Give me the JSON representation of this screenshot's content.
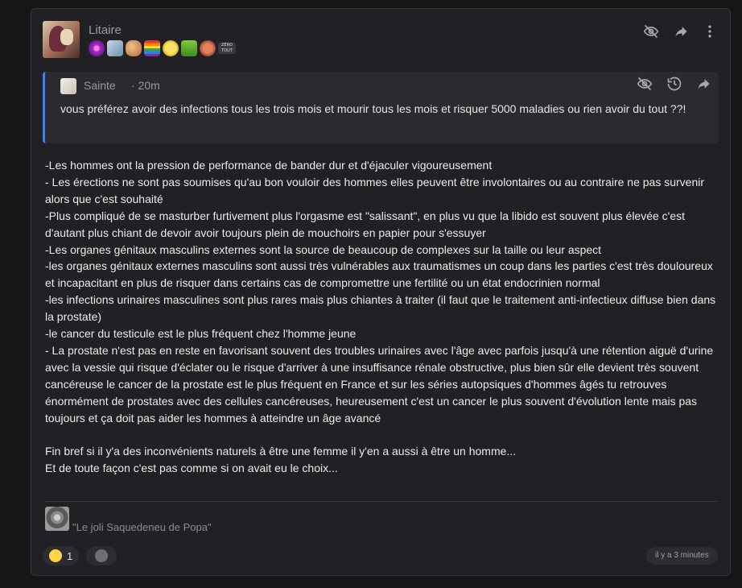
{
  "post": {
    "author": "Litaire",
    "badges": [
      "spiral-badge",
      "character-badge",
      "figure-badge",
      "rainbow-flag-badge",
      "smiley-badge",
      "green-badge",
      "face-badge",
      "text-badge"
    ],
    "badge_text": "ZÉRO TOUT",
    "actions": [
      "hide-icon",
      "share-icon",
      "more-icon"
    ]
  },
  "quote": {
    "author": "Sainte",
    "time": "· 20m",
    "text": "vous préférez avoir des infections tous les trois mois et mourir tous les mois et risquer 5000 maladies ou rien avoir du tout ??!",
    "actions": [
      "hide-icon",
      "history-icon",
      "share-icon"
    ]
  },
  "body": {
    "lines": [
      "-Les hommes ont la pression de performance de bander dur et d'éjaculer vigoureusement",
      "- Les érections ne sont pas soumises qu'au bon vouloir des hommes elles peuvent être involontaires ou au contraire ne pas survenir alors que c'est souhaité",
      "-Plus compliqué de se masturber furtivement plus l'orgasme est \"salissant\", en plus vu que la libido est souvent plus élevée c'est d'autant plus chiant de devoir avoir toujours plein de mouchoirs en papier pour s'essuyer",
      "-Les organes génitaux masculins externes sont la source de beaucoup de complexes sur la taille ou leur aspect",
      "-les organes génitaux externes masculins sont aussi très vulnérables aux traumatismes un coup dans les parties c'est très douloureux et incapacitant en plus de risquer dans certains cas de compromettre une fertilité ou un état endocrinien normal",
      "-les infections urinaires masculines sont plus rares mais plus chiantes à traiter (il faut que le traitement anti-infectieux diffuse bien dans la prostate)",
      "-le cancer du testicule est le plus fréquent chez l'homme jeune",
      "- La prostate n'est pas en reste en favorisant souvent des troubles urinaires avec l'âge avec parfois jusqu'à une rétention aiguë d'urine avec la vessie qui risque d'éclater ou le risque d'arriver à une insuffisance rénale obstructive, plus bien sûr elle devient très souvent cancéreuse le cancer de la prostate est le plus fréquent en France et sur les séries autopsiques d'hommes âgés tu retrouves énormément de prostates avec des cellules cancéreuses, heureusement c'est un cancer le plus souvent d'évolution lente mais pas toujours et ça doit pas aider les hommes à atteindre un âge avancé"
    ],
    "closing": [
      "Fin bref si il y'a des inconvénients naturels à être une femme il y'en a aussi à être un homme...",
      "Et de toute façon c'est pas comme si on avait eu le choix..."
    ]
  },
  "signature": {
    "text": "\"Le joli Saquedeneu de Popa\""
  },
  "reactions": [
    {
      "emoji": "laughing-emoji",
      "count": "1"
    },
    {
      "emoji": "add-reaction-icon",
      "count": ""
    }
  ],
  "timestamp": "il y a 3 minutes"
}
